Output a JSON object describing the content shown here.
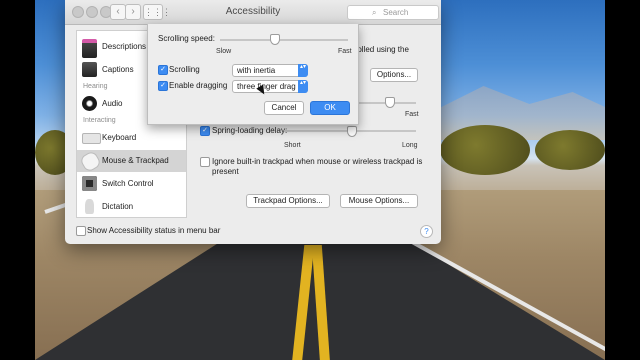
{
  "window": {
    "title": "Accessibility",
    "search_glyph": "⌕",
    "search_placeholder": "Search",
    "nav_back": "‹",
    "nav_forward": "›",
    "grid_glyph": "⋮⋮⋮"
  },
  "sidebar": {
    "items": [
      {
        "label": "Descriptions",
        "icon": "descriptions-icon"
      },
      {
        "label": "Captions",
        "icon": "captions-icon"
      },
      {
        "label": "Audio",
        "icon": "speaker-icon"
      },
      {
        "label": "Keyboard",
        "icon": "keyboard-icon"
      },
      {
        "label": "Mouse & Trackpad",
        "icon": "mouse-icon"
      },
      {
        "label": "Switch Control",
        "icon": "switch-control-icon"
      },
      {
        "label": "Dictation",
        "icon": "microphone-icon"
      }
    ],
    "headers": {
      "hearing": "Hearing",
      "interacting": "Interacting"
    },
    "selected": "Mouse & Trackpad"
  },
  "content": {
    "controlled_text": "ntrolled using the",
    "options_button": "Options...",
    "double_click_fast": "Fast",
    "spring_loading_label": "Spring-loading delay:",
    "spring_short": "Short",
    "spring_long": "Long",
    "ignore_trackpad_line1": "Ignore built-in trackpad when mouse or wireless trackpad is",
    "ignore_trackpad_line2": "present",
    "trackpad_options_button": "Trackpad Options...",
    "mouse_options_button": "Mouse Options..."
  },
  "footer": {
    "show_status_label": "Show Accessibility status in menu bar",
    "help": "?"
  },
  "sheet": {
    "scrolling_speed_label": "Scrolling speed:",
    "slow": "Slow",
    "fast": "Fast",
    "scrolling_speed_level": 0.42,
    "scrolling_label": "Scrolling",
    "scrolling_value": "with inertia",
    "dragging_label": "Enable dragging",
    "dragging_value": "three finger drag",
    "cancel": "Cancel",
    "ok": "OK",
    "check": "✓",
    "popup_arrows": "▴▾"
  },
  "colors": {
    "accent": "#3d8cf2",
    "window_bg": "#ececec",
    "road_line": "#e2b321"
  }
}
